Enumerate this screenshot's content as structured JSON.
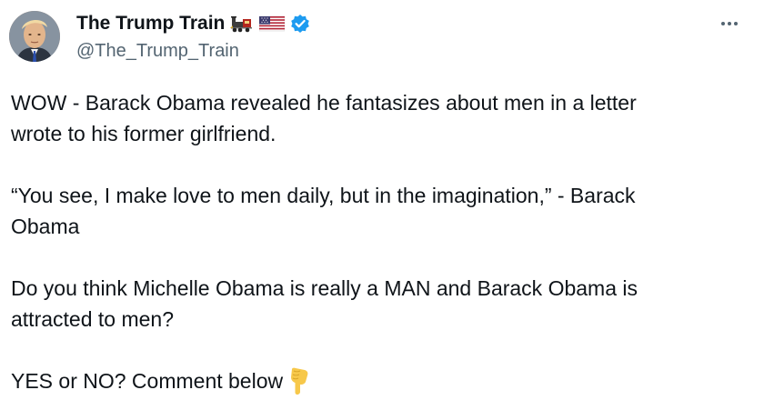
{
  "tweet": {
    "author": {
      "display_name": "The Trump Train",
      "handle": "@The_Trump_Train",
      "verified": true,
      "name_emojis": [
        "train-icon",
        "us-flag-icon"
      ]
    },
    "paragraphs": [
      "WOW - Barack Obama revealed he fantasizes about men in a letter\nwrote to his former girlfriend.",
      "“You see, I make love to men daily, but in the imagination,” - Barack\nObama",
      "Do you think Michelle Obama is really a MAN and Barack Obama is\nattracted to men?"
    ],
    "final_line": "YES or NO? Comment below",
    "final_emoji": "pointing-down-icon"
  },
  "colors": {
    "text": "#0f1419",
    "secondary": "#536471",
    "verified": "#1d9bf0",
    "background": "#ffffff"
  }
}
